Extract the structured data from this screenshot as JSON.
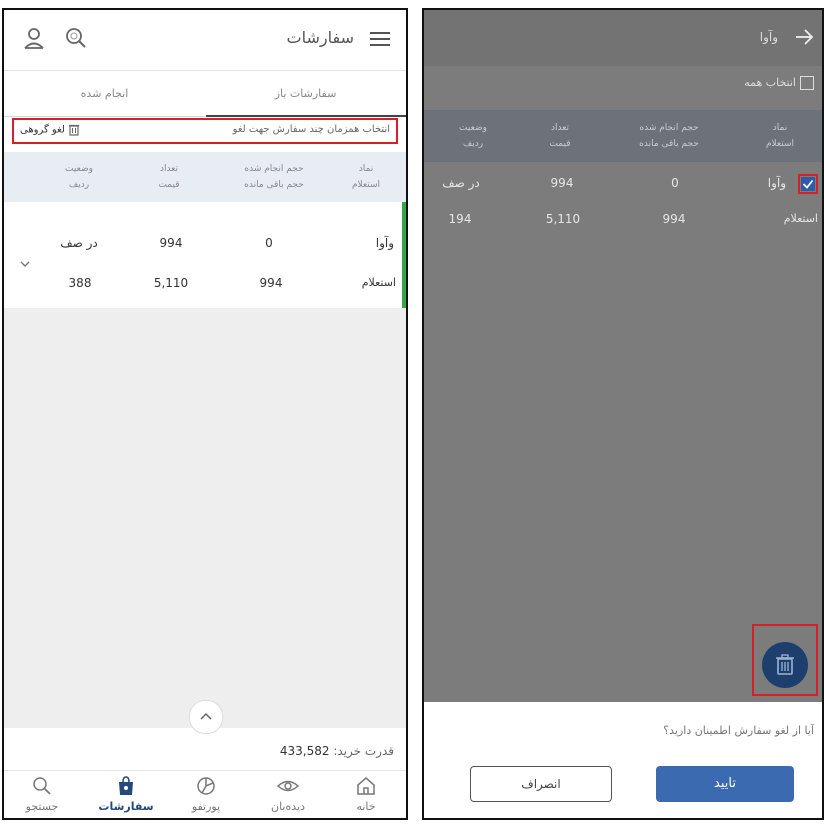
{
  "left": {
    "header": {
      "title": "سفارشات"
    },
    "tabs": {
      "open": "سفارشات باز",
      "done": "انجام شده"
    },
    "bulk": {
      "hint": "انتخاب همزمان چند سفارش جهت لغو",
      "cancel_label": "لغو گروهی"
    },
    "table_headers": [
      [
        "نماد",
        "استعلام"
      ],
      [
        "حجم انجام شده",
        "حجم باقی مانده"
      ],
      [
        "تعداد",
        "قیمت"
      ],
      [
        "وضعیت",
        "ردیف"
      ]
    ],
    "order": {
      "symbol": "وآوا",
      "executed": "0",
      "count": "994",
      "status": "در صف",
      "inquiry": "استعلام",
      "remaining": "994",
      "price": "5,110",
      "row": "388"
    },
    "buying_power": {
      "label": "قدرت خرید:",
      "value": "433,582"
    },
    "nav": [
      "خانه",
      "دیده‌بان",
      "پورتفو",
      "سفارشات",
      "جستجو"
    ]
  },
  "right": {
    "header": {
      "title": "وآوا"
    },
    "select_all": "انتخاب همه",
    "table_headers": [
      [
        "نماد",
        "استعلام"
      ],
      [
        "حجم انجام شده",
        "حجم باقی مانده"
      ],
      [
        "تعداد",
        "قیمت"
      ],
      [
        "وضعیت",
        "ردیف"
      ]
    ],
    "order": {
      "symbol": "وآوا",
      "executed": "0",
      "count": "994",
      "status": "در صف",
      "inquiry": "استعلام",
      "remaining": "994",
      "price": "5,110",
      "row": "194"
    },
    "confirm": {
      "question": "آیا از لغو سفارش اطمینان دارید؟",
      "ok": "تایید",
      "cancel": "انصراف"
    }
  },
  "colors": {
    "accent": "#3b6ab0",
    "navy": "#1d3f6e",
    "highlight": "#d42027",
    "status_bar": "#3aa44a"
  }
}
